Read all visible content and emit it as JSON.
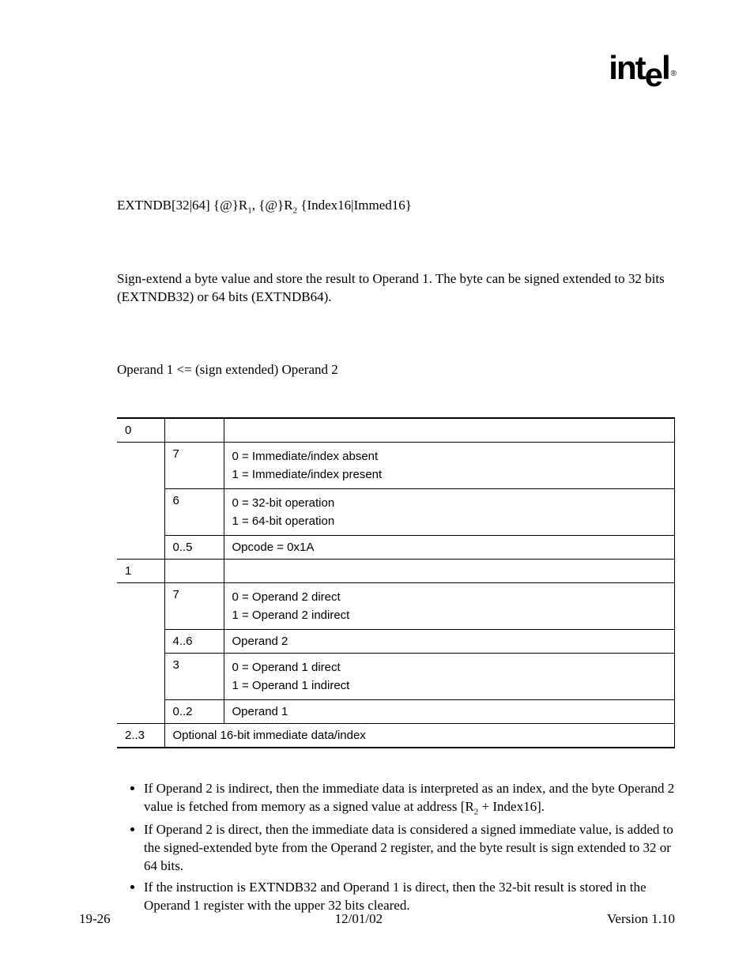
{
  "logo": {
    "text_int": "int",
    "text_el": "l",
    "drop": "e",
    "reg": "®"
  },
  "syntax": {
    "pre": "EXTNDB[32|64]  {@}R",
    "s1": "1",
    "mid": ", {@}R",
    "s2": "2",
    "post": " {Index16|Immed16}"
  },
  "description": "Sign-extend a byte value and store the result to Operand 1. The byte can be signed extended to 32 bits (EXTNDB32) or 64 bits (EXTNDB64).",
  "operation": "Operand 1 <= (sign extended) Operand 2",
  "table": {
    "rows": [
      {
        "byte": "0",
        "bit": "",
        "desc_a": "",
        "desc_b": ""
      },
      {
        "byte": "",
        "bit": "7",
        "desc_a": "0 = Immediate/index absent",
        "desc_b": "1 = Immediate/index present"
      },
      {
        "byte": "",
        "bit": "6",
        "desc_a": "0 = 32-bit operation",
        "desc_b": "1 = 64-bit operation"
      },
      {
        "byte": "",
        "bit": "0..5",
        "desc_a": "Opcode = 0x1A",
        "desc_b": ""
      },
      {
        "byte": "1",
        "bit": "",
        "desc_a": "",
        "desc_b": ""
      },
      {
        "byte": "",
        "bit": "7",
        "desc_a": "0 = Operand 2 direct",
        "desc_b": "1 = Operand 2 indirect"
      },
      {
        "byte": "",
        "bit": "4..6",
        "desc_a": "Operand 2",
        "desc_b": ""
      },
      {
        "byte": "",
        "bit": "3",
        "desc_a": "0 = Operand 1 direct",
        "desc_b": "1 = Operand 1 indirect"
      },
      {
        "byte": "",
        "bit": "0..2",
        "desc_a": "Operand 1",
        "desc_b": ""
      }
    ],
    "footer_byte": "2..3",
    "footer_desc": "Optional 16-bit immediate data/index"
  },
  "notes": {
    "n1_a": "If Operand 2 is indirect, then the immediate data is interpreted as an index, and the byte Operand 2 value is fetched from memory as a signed value at address [R",
    "n1_sub": "2",
    "n1_b": " + Index16].",
    "n2": "If Operand 2 is direct, then the immediate data is considered a signed immediate value, is added to the signed-extended byte from the Operand 2 register, and the byte result is sign extended to 32 or 64 bits.",
    "n3": "If the instruction is EXTNDB32 and Operand 1 is direct, then the 32-bit result is stored in the Operand 1 register with the upper 32 bits cleared."
  },
  "footer": {
    "left": "19-26",
    "center": "12/01/02",
    "right": "Version 1.10"
  }
}
